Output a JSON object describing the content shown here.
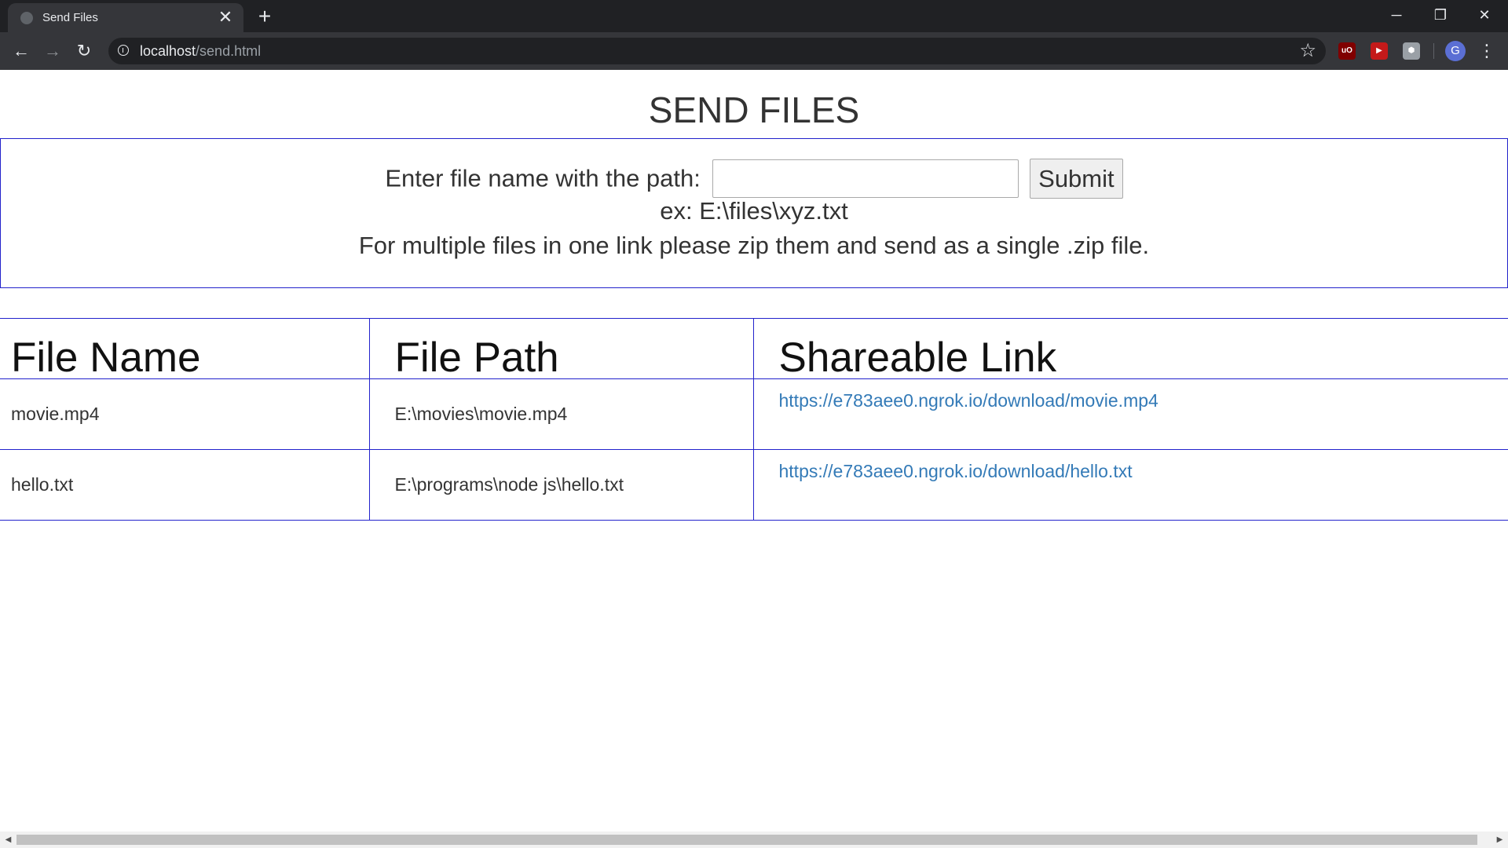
{
  "browser": {
    "tab_title": "Send Files",
    "tab_close": "✕",
    "new_tab": "+",
    "url_host": "localhost",
    "url_path": "/send.html",
    "controls": {
      "minimize": "─",
      "restore": "❐",
      "close": "✕"
    },
    "extensions": [
      {
        "name": "ublock-icon",
        "glyph": "uO",
        "color": "#800000"
      },
      {
        "name": "video-ext-icon",
        "glyph": "▶",
        "color": "#c41a1a"
      },
      {
        "name": "cube-ext-icon",
        "glyph": "⬢",
        "color": "#9aa0a6"
      }
    ],
    "avatar_letter": "G"
  },
  "page": {
    "title": "SEND FILES",
    "form": {
      "label": "Enter file name with the path:",
      "input_value": "",
      "submit_label": "Submit",
      "example": "ex: E:\\files\\xyz.txt",
      "note": "For multiple files in one link please zip them and send as a single .zip file."
    },
    "table": {
      "headers": [
        "File Name",
        "File Path",
        "Shareable Link"
      ],
      "rows": [
        {
          "name": "movie.mp4",
          "path": "E:\\movies\\movie.mp4",
          "link": "https://e783aee0.ngrok.io/download/movie.mp4"
        },
        {
          "name": "hello.txt",
          "path": "E:\\programs\\node js\\hello.txt",
          "link": "https://e783aee0.ngrok.io/download/hello.txt"
        }
      ]
    }
  },
  "colors": {
    "table_border": "#2222cc",
    "link": "#337ab7",
    "chrome_dark": "#202124",
    "chrome_toolbar": "#35363a"
  }
}
